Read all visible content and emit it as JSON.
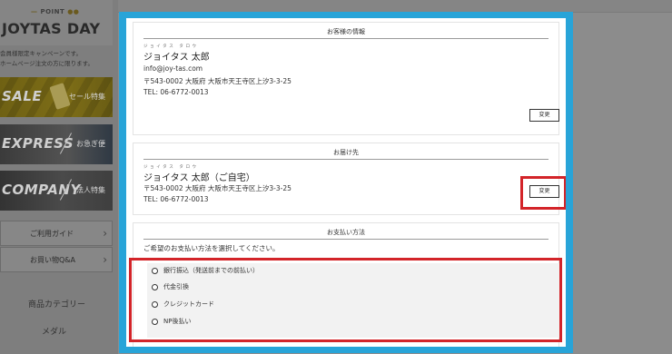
{
  "sidebar": {
    "point_label": "POINT",
    "day_title": "JOYTAS DAY",
    "promo_line1": "会員様限定キャンペーンです。",
    "promo_line2": "ホームページ注文の方に限ります。",
    "banners": [
      {
        "big": "SALE",
        "sub": "セール特集"
      },
      {
        "big": "EXPRESS",
        "sub": "お急ぎ便"
      },
      {
        "big": "COMPANY",
        "sub": "法人特集"
      }
    ],
    "links": [
      {
        "label": "ご利用ガイド"
      },
      {
        "label": "お買い物Q&A"
      }
    ],
    "category_heading": "商品カテゴリー",
    "category_item": "メダル"
  },
  "customer": {
    "title": "お客様の情報",
    "ruby": "ジョイタス タロウ",
    "name": "ジョイタス 太郎",
    "email": "info@joy-tas.com",
    "address": "〒543-0002 大阪府 大阪市天王寺区上汐3-3-25",
    "tel": "TEL: 06-6772-0013",
    "change_label": "変更"
  },
  "delivery": {
    "title": "お届け先",
    "ruby": "ジョイタス タロウ",
    "name": "ジョイタス 太郎（ご自宅）",
    "address": "〒543-0002 大阪府 大阪市天王寺区上汐3-3-25",
    "tel": "TEL: 06-6772-0013",
    "change_label": "変更"
  },
  "payment": {
    "title": "お支払い方法",
    "instruction": "ご希望のお支払い方法を選択してください。",
    "options": [
      {
        "label": "銀行振込（発送前までの前払い）"
      },
      {
        "label": "代金引換"
      },
      {
        "label": "クレジットカード"
      },
      {
        "label": "NP後払い"
      }
    ]
  },
  "colors": {
    "modal_border": "#28a4d8",
    "highlight": "#d32429"
  }
}
